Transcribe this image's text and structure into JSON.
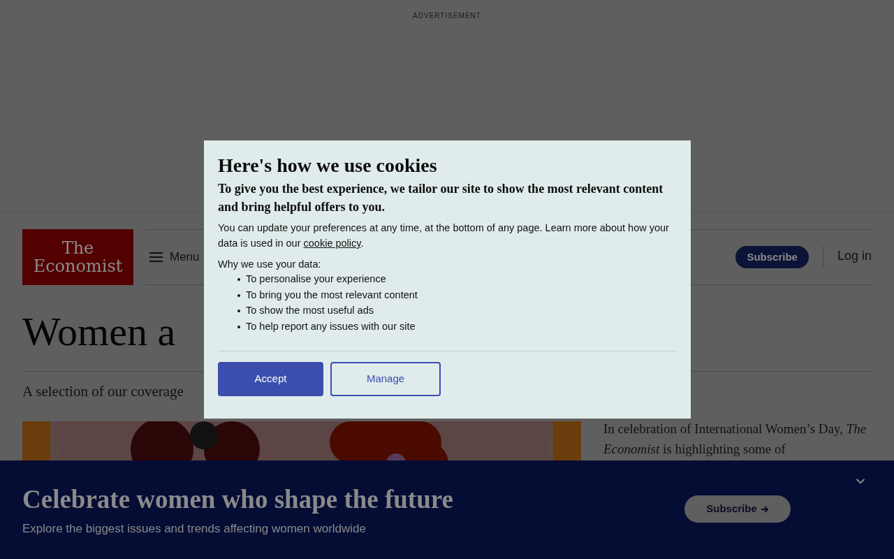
{
  "advertisement": {
    "label": "ADVERTISEMENT"
  },
  "header": {
    "logo": [
      "The",
      "Economist"
    ],
    "menu": "Menu",
    "subscribe": "Subscribe",
    "login": "Log in"
  },
  "article": {
    "title": "Women a",
    "subtitle": "A selection of our coverage",
    "intro": "In celebration of International Women’s Day, *The Economist* is highlighting some of"
  },
  "cookie_dialog": {
    "title": "Here's how we use cookies",
    "lead": "To give you the best experience, we tailor our site to show the most relevant content and bring helpful offers to you.",
    "text_before_link": "You can update your preferences at any time, at the bottom of any page. Learn more about how your data is used in our",
    "link": "cookie policy",
    "text_after_link": ".",
    "reasons_heading": "Why we use your data:",
    "reasons": [
      "To personalise your experience",
      "To bring you the most relevant content",
      "To show the most useful ads",
      "To help report any issues with our site"
    ],
    "buttons": [
      {
        "label": "Accept",
        "kind": "primary"
      },
      {
        "label": "Manage",
        "kind": "secondary"
      }
    ]
  },
  "banner": {
    "title": "Celebrate women who shape the future",
    "text": "Explore the biggest issues and trends affecting women worldwide",
    "subscribe": "Subscribe",
    "expanded": false
  }
}
